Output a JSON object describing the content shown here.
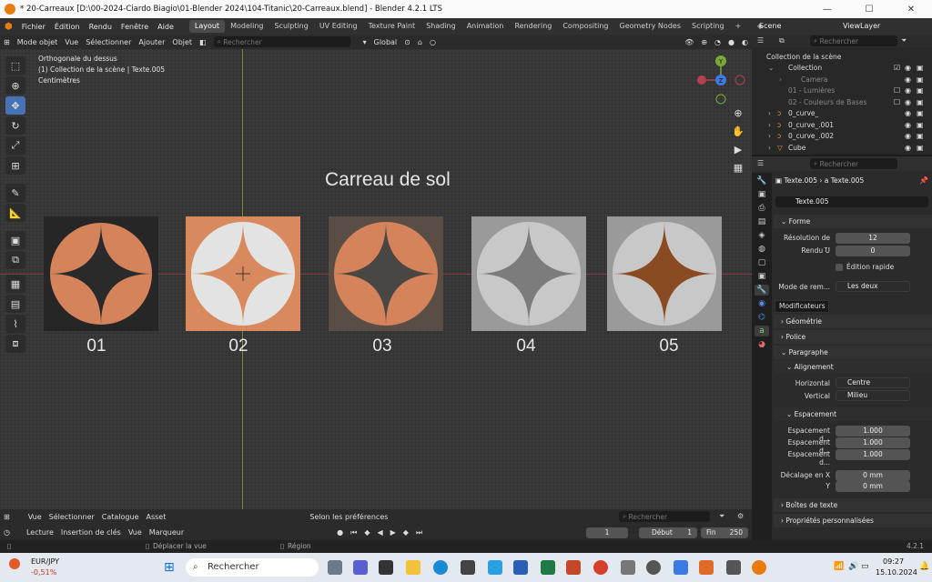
{
  "window": {
    "title": "* 20-Carreaux [D:\\00-2024-Ciardo Biagio\\01-Blender 2024\\104-Titanic\\20-Carreaux.blend] - Blender 4.2.1 LTS"
  },
  "menu": [
    "Fichier",
    "Édition",
    "Rendu",
    "Fenêtre",
    "Aide"
  ],
  "workspaces": [
    "Layout",
    "Modeling",
    "Sculpting",
    "UV Editing",
    "Texture Paint",
    "Shading",
    "Animation",
    "Rendering",
    "Compositing",
    "Geometry Nodes",
    "Scripting"
  ],
  "scene": {
    "label": "Scene",
    "viewlayer": "ViewLayer"
  },
  "vpheader": {
    "mode": "Mode objet",
    "vue": "Vue",
    "select": "Sélectionner",
    "add": "Ajouter",
    "object": "Objet",
    "search": "Rechercher",
    "transform": "Global"
  },
  "viewinfo": {
    "line1": "Orthogonale du dessus",
    "line2": "(1) Collection de la scène | Texte.005",
    "line3": "Centimètres"
  },
  "canvas": {
    "title": "Carreau de sol",
    "tiles": [
      "01",
      "02",
      "03",
      "04",
      "05"
    ]
  },
  "gizmo": {
    "y": "Y",
    "z": "Z",
    "x": "X"
  },
  "outliner": {
    "search": "Rechercher",
    "rows": [
      {
        "label": "Collection de la scène"
      },
      {
        "label": "Collection"
      },
      {
        "label": "Camera"
      },
      {
        "label": "01 - Lumières"
      },
      {
        "label": "02 - Couleurs de Bases"
      },
      {
        "label": "0_curve_"
      },
      {
        "label": "0_curve_.001"
      },
      {
        "label": "0_curve_.002"
      },
      {
        "label": "Cube"
      }
    ]
  },
  "props": {
    "search": "Rechercher",
    "breadcrumb1": "Texte.005",
    "breadcrumb2": "Texte.005",
    "datablock": "Texte.005",
    "sections": {
      "forme": "Forme",
      "geometrie": "Géométrie",
      "police": "Police",
      "paragraphe": "Paragraphe",
      "alignement": "Alignement",
      "espacement": "Espacement",
      "boites": "Boîtes de texte",
      "custom": "Propriétés personnalisées"
    },
    "resolution_label": "Résolution de ...",
    "resolution": "12",
    "renduu_label": "Rendu U",
    "renduu": "0",
    "fastedit": "Édition rapide",
    "fillmode_label": "Mode de rem...",
    "fillmode": "Les deux",
    "horizontal_label": "Horizontal",
    "horizontal": "Centre",
    "vertical_label": "Vertical",
    "vertical": "Milieu",
    "spacing1_label": "Espacement d...",
    "spacing1": "1.000",
    "spacing2_label": "Espacement d...",
    "spacing2": "1.000",
    "spacing3_label": "Espacement d...",
    "spacing3": "1.000",
    "offsetx_label": "Décalage en X",
    "offsetx": "0 mm",
    "offsety_label": "Y",
    "offsety": "0 mm",
    "tooltip": "Modificateurs"
  },
  "assetbar": {
    "vue": "Vue",
    "select": "Sélectionner",
    "catalog": "Catalogue",
    "asset": "Asset",
    "prefs": "Selon les préférences",
    "search": "Rechercher"
  },
  "timeline": {
    "lecture": "Lecture",
    "keys": "Insertion de clés",
    "vue": "Vue",
    "markers": "Marqueur",
    "frame": "1",
    "start_label": "Début",
    "start": "1",
    "end_label": "Fin",
    "end": "250"
  },
  "status": {
    "move": "Déplacer la vue",
    "region": "Région",
    "version": "4.2.1"
  },
  "taskbar": {
    "ticker": "EUR/JPY",
    "change": "-0,51%",
    "search": "Rechercher",
    "time": "09:27",
    "date": "15.10.2024"
  }
}
